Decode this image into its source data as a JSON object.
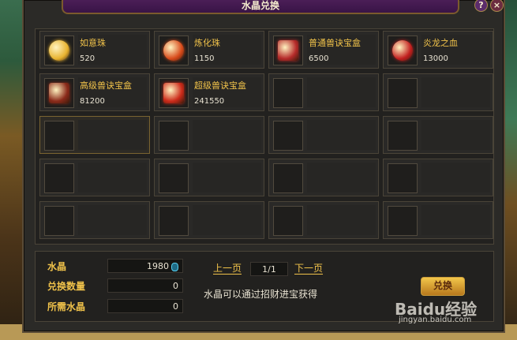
{
  "window": {
    "title": "水晶兑换"
  },
  "items": [
    {
      "name": "如意珠",
      "cost": "520",
      "icon": "gold-orb-icon",
      "color": "#e8b330"
    },
    {
      "name": "炼化珠",
      "cost": "1150",
      "icon": "red-gold-orb-icon",
      "color": "#d84a1a"
    },
    {
      "name": "普通兽诀宝盒",
      "cost": "6500",
      "icon": "red-chest-icon",
      "color": "#b52a2a"
    },
    {
      "name": "炎龙之血",
      "cost": "13000",
      "icon": "blood-potion-icon",
      "color": "#c21f1f"
    },
    {
      "name": "高级兽诀宝盒",
      "cost": "81200",
      "icon": "open-chest-icon",
      "color": "#8a2a1a"
    },
    {
      "name": "超级兽诀宝盒",
      "cost": "241550",
      "icon": "gold-chest-icon",
      "color": "#cc2a1a"
    }
  ],
  "form": {
    "crystal_label": "水晶",
    "crystal_value": "1980",
    "quantity_label": "兑换数量",
    "quantity_value": "0",
    "required_label": "所需水晶",
    "required_value": "0"
  },
  "pager": {
    "prev": "上一页",
    "page": "1/1",
    "next": "下一页"
  },
  "hint": "水晶可以通过招财进宝获得",
  "exchange_button": "兑换",
  "watermark": {
    "main": "Baidu经验",
    "sub": "jingyan.baidu.com"
  }
}
